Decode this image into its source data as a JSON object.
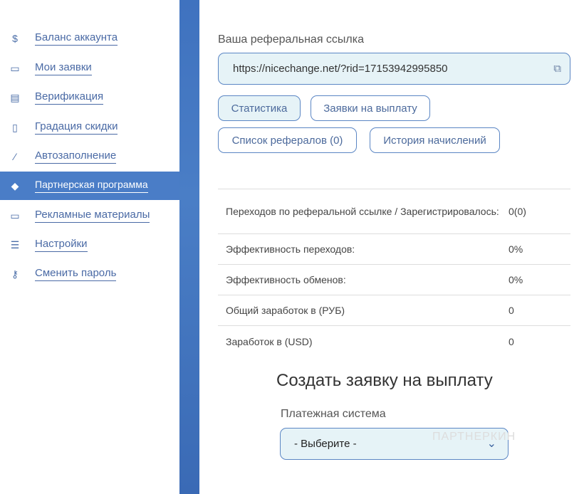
{
  "sidebar": {
    "items": [
      {
        "label": "Баланс аккаунта",
        "icon": "money-bag-icon",
        "glyph": "$"
      },
      {
        "label": "Мои заявки",
        "icon": "briefcase-icon",
        "glyph": "▭"
      },
      {
        "label": "Верификация",
        "icon": "id-card-icon",
        "glyph": "▤"
      },
      {
        "label": "Градация скидки",
        "icon": "badge-icon",
        "glyph": "▯"
      },
      {
        "label": "Автозаполнение",
        "icon": "magic-wand-icon",
        "glyph": "⁄"
      },
      {
        "label": "Партнерская программа",
        "icon": "diamond-icon",
        "glyph": "◆"
      },
      {
        "label": "Рекламные материалы",
        "icon": "folder-icon",
        "glyph": "▭"
      },
      {
        "label": "Настройки",
        "icon": "sliders-icon",
        "glyph": "☰"
      },
      {
        "label": "Сменить пароль",
        "icon": "key-icon",
        "glyph": "⚷"
      }
    ],
    "active": 5
  },
  "referral": {
    "label": "Ваша реферальная ссылка",
    "link": "https://nicechange.net/?rid=17153942995850",
    "copy_glyph": "⧉"
  },
  "tabs": [
    {
      "label": "Статистика",
      "active": true
    },
    {
      "label": "Заявки на выплату"
    },
    {
      "label": "Список рефералов (0)"
    },
    {
      "label": "История начислений"
    }
  ],
  "stats": [
    {
      "key": "Переходов по реферальной ссылке / Зарегистрировалось:",
      "value": "0(0)"
    },
    {
      "key": "Эффективность переходов:",
      "value": "0%"
    },
    {
      "key": "Эффективность обменов:",
      "value": "0%"
    },
    {
      "key": "Общий заработок в (РУБ)",
      "value": "0"
    },
    {
      "key": "Заработок в (USD)",
      "value": "0"
    }
  ],
  "payout": {
    "title": "Создать заявку на выплату",
    "system_label": "Платежная система",
    "system_value": "- Выберите -"
  },
  "watermark": "ПАРТНЕРКИН",
  "colors": {
    "accent": "#4a7dc7",
    "field_bg": "#e6f3f7"
  }
}
